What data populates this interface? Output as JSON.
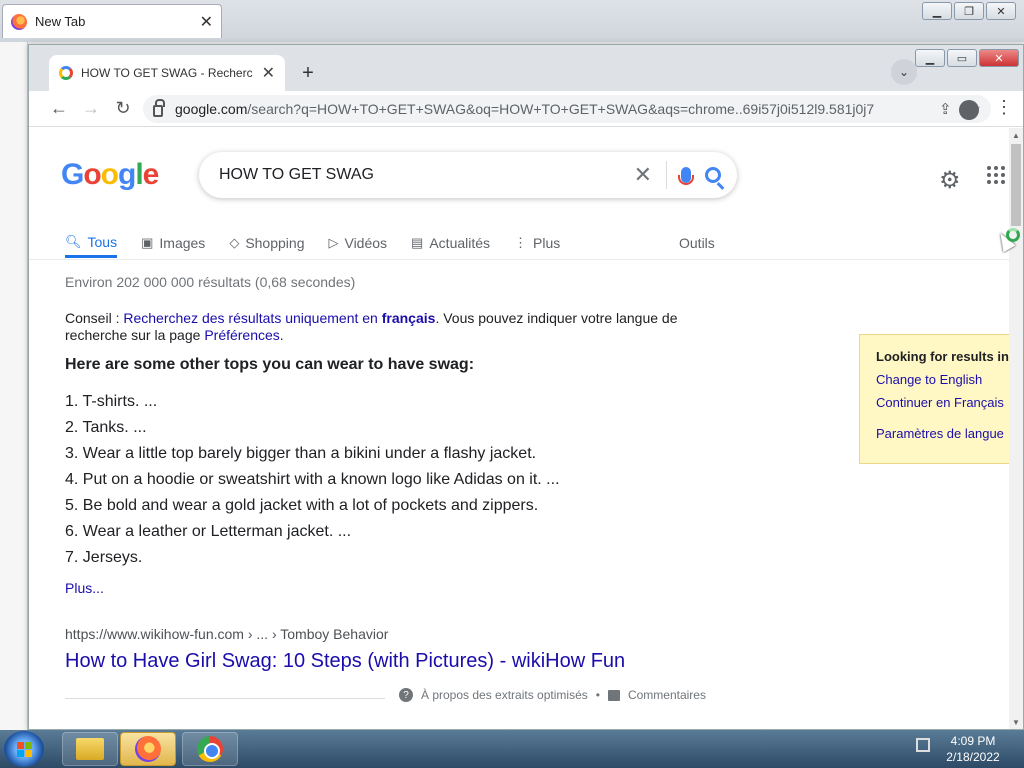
{
  "firefox": {
    "tab_title": "New Tab"
  },
  "chrome": {
    "tab_title": "HOW TO GET SWAG - Recherche",
    "url_host": "google.com",
    "url_rest": "/search?q=HOW+TO+GET+SWAG&oq=HOW+TO+GET+SWAG&aqs=chrome..69i57j0i512l9.581j0j7..."
  },
  "google": {
    "logo_letters": [
      "G",
      "o",
      "o",
      "g",
      "l",
      "e"
    ],
    "query": "HOW TO GET SWAG",
    "nav": {
      "tous": "Tous",
      "images": "Images",
      "shopping": "Shopping",
      "videos": "Vidéos",
      "actualites": "Actualités",
      "plus": "Plus",
      "outils": "Outils"
    },
    "stats": "Environ 202 000 000 résultats (0,68 secondes)",
    "tip": {
      "prefix": "Conseil : ",
      "link1": "Recherchez des résultats uniquement en ",
      "link_bold": "français",
      "middle": ". Vous pouvez indiquer votre langue de recherche sur la page ",
      "link2": "Préférences",
      "suffix": "."
    },
    "snippet_title": "Here are some other tops you can wear to have swag:",
    "list": [
      "T-shirts. ...",
      "Tanks. ...",
      "Wear a little top barely bigger than a bikini under a flashy jacket.",
      "Put on a hoodie or sweatshirt with a known logo like Adidas on it. ...",
      "Be bold and wear a gold jacket with a lot of pockets and zippers.",
      "Wear a leather or Letterman jacket. ...",
      "Jerseys."
    ],
    "plus_link": "Plus...",
    "result": {
      "cite": "https://www.wikihow-fun.com › ... › Tomboy Behavior",
      "title": "How to Have Girl Swag: 10 Steps (with Pictures) - wikiHow Fun"
    },
    "about": "À propos des extraits optimisés",
    "dot": "•",
    "feedback": "Commentaires",
    "lang_box": {
      "heading": "Looking for results in",
      "english": "Change to English",
      "francais": "Continuer en Français",
      "settings": "Paramètres de langue"
    }
  },
  "taskbar": {
    "time": "4:09 PM",
    "date": "2/18/2022"
  },
  "colors": {
    "link": "#1a0dab",
    "accent": "#1a73e8",
    "lang_box_bg": "#fff8c5"
  }
}
